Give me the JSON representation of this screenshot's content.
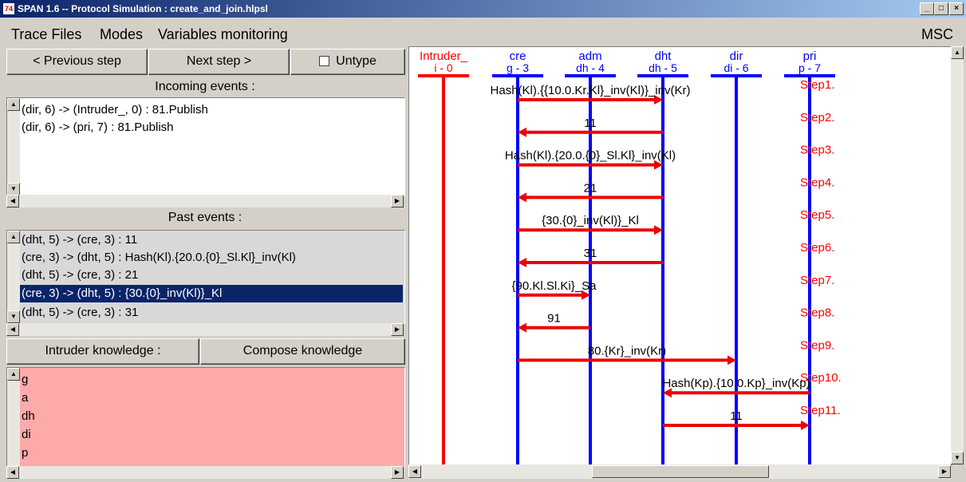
{
  "window": {
    "title": "SPAN 1.6 -- Protocol Simulation : create_and_join.hlpsl"
  },
  "menu": {
    "trace_files": "Trace Files",
    "modes": "Modes",
    "variables": "Variables monitoring",
    "msc": "MSC"
  },
  "controls": {
    "prev": "< Previous step",
    "next": "Next step >",
    "untype": "Untype"
  },
  "incoming": {
    "header": "Incoming events :",
    "items": [
      "(dir, 6) -> (Intruder_, 0) : 81.Publish",
      "(dir, 6) -> (pri, 7) : 81.Publish"
    ]
  },
  "past": {
    "header": "Past events :",
    "items": [
      "(dht, 5) -> (cre, 3) : 11",
      "(cre, 3) -> (dht, 5) : Hash(Kl).{20.0.{0}_Sl.Kl}_inv(Kl)",
      "(dht, 5) -> (cre, 3) : 21",
      "(cre, 3) -> (dht, 5) : {30.{0}_inv(Kl)}_Kl",
      "(dht, 5) -> (cre, 3) : 31"
    ],
    "selected_index": 3
  },
  "knowledge": {
    "intruder_label": "Intruder knowledge :",
    "compose_label": "Compose knowledge",
    "items": [
      "g",
      "a",
      "dh",
      "di",
      "p"
    ]
  },
  "chart_data": {
    "type": "sequence",
    "participants": [
      {
        "name": "Intruder_",
        "id": "i - 0",
        "color": "#ff0000"
      },
      {
        "name": "cre",
        "id": "g - 3",
        "color": "#0000ff"
      },
      {
        "name": "adm",
        "id": "dh - 4",
        "color": "#0000ff"
      },
      {
        "name": "dht",
        "id": "dh - 5",
        "color": "#0000ff"
      },
      {
        "name": "dir",
        "id": "di - 6",
        "color": "#0000ff"
      },
      {
        "name": "pri",
        "id": "p - 7",
        "color": "#0000ff"
      }
    ],
    "messages": [
      {
        "step": "Step1.",
        "from": 1,
        "to": 3,
        "label": "Hash(Kl).{{10.0.Kr.Kl}_inv(Kl)}_inv(Kr)"
      },
      {
        "step": "Step2.",
        "from": 3,
        "to": 1,
        "label": "11"
      },
      {
        "step": "Step3.",
        "from": 1,
        "to": 3,
        "label": "Hash(Kl).{20.0.{0}_Sl.Kl}_inv(Kl)"
      },
      {
        "step": "Step4.",
        "from": 3,
        "to": 1,
        "label": "21"
      },
      {
        "step": "Step5.",
        "from": 1,
        "to": 3,
        "label": "{30.{0}_inv(Kl)}_Kl"
      },
      {
        "step": "Step6.",
        "from": 3,
        "to": 1,
        "label": "31"
      },
      {
        "step": "Step7.",
        "from": 1,
        "to": 2,
        "label": "{90.Kl.Sl.Ki}_Sa"
      },
      {
        "step": "Step8.",
        "from": 2,
        "to": 1,
        "label": "91"
      },
      {
        "step": "Step9.",
        "from": 1,
        "to": 4,
        "label": "80.{Kr}_inv(Kr)"
      },
      {
        "step": "Step10.",
        "from": 5,
        "to": 3,
        "label": "Hash(Kp).{10.0.Kp}_inv(Kp)"
      },
      {
        "step": "Step11.",
        "from": 3,
        "to": 5,
        "label": "11"
      }
    ],
    "step_color": "#ff0000",
    "arrow_color": "#ee0000"
  }
}
